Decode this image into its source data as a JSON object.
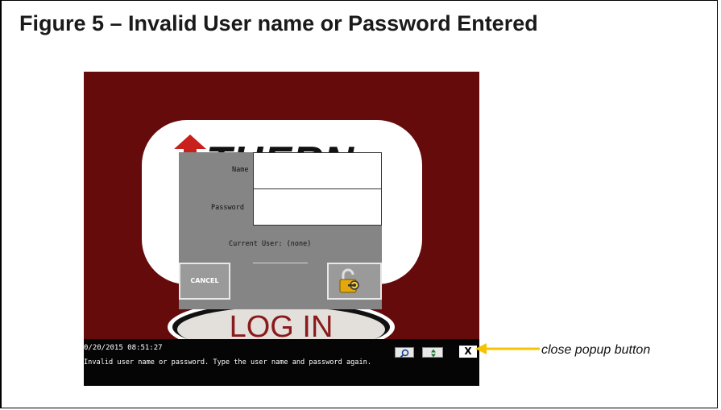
{
  "figure": {
    "title": "Figure 5 – Invalid User name or Password Entered"
  },
  "background": {
    "logo_text": "THERN",
    "login_button": "LOG IN"
  },
  "dialog": {
    "name_label": "Name",
    "name_value": "",
    "password_label": "Password",
    "password_value": "",
    "current_user_text": "Current User: (none)",
    "cancel_label": "CANCEL",
    "login_icon": "unlocked-padlock-key-icon"
  },
  "statusbar": {
    "timestamp": "0/20/2015 08:51:27",
    "message": "Invalid user name or password. Type the user name and password again.",
    "buttons": [
      "magnifier-icon",
      "scroll-arrows-icon"
    ],
    "close_label": "X"
  },
  "annotation": {
    "callout_text": "close popup button",
    "arrow_color": "#f5c400"
  },
  "colors": {
    "screen_background": "#650b0c",
    "dialog_background": "#858585"
  }
}
